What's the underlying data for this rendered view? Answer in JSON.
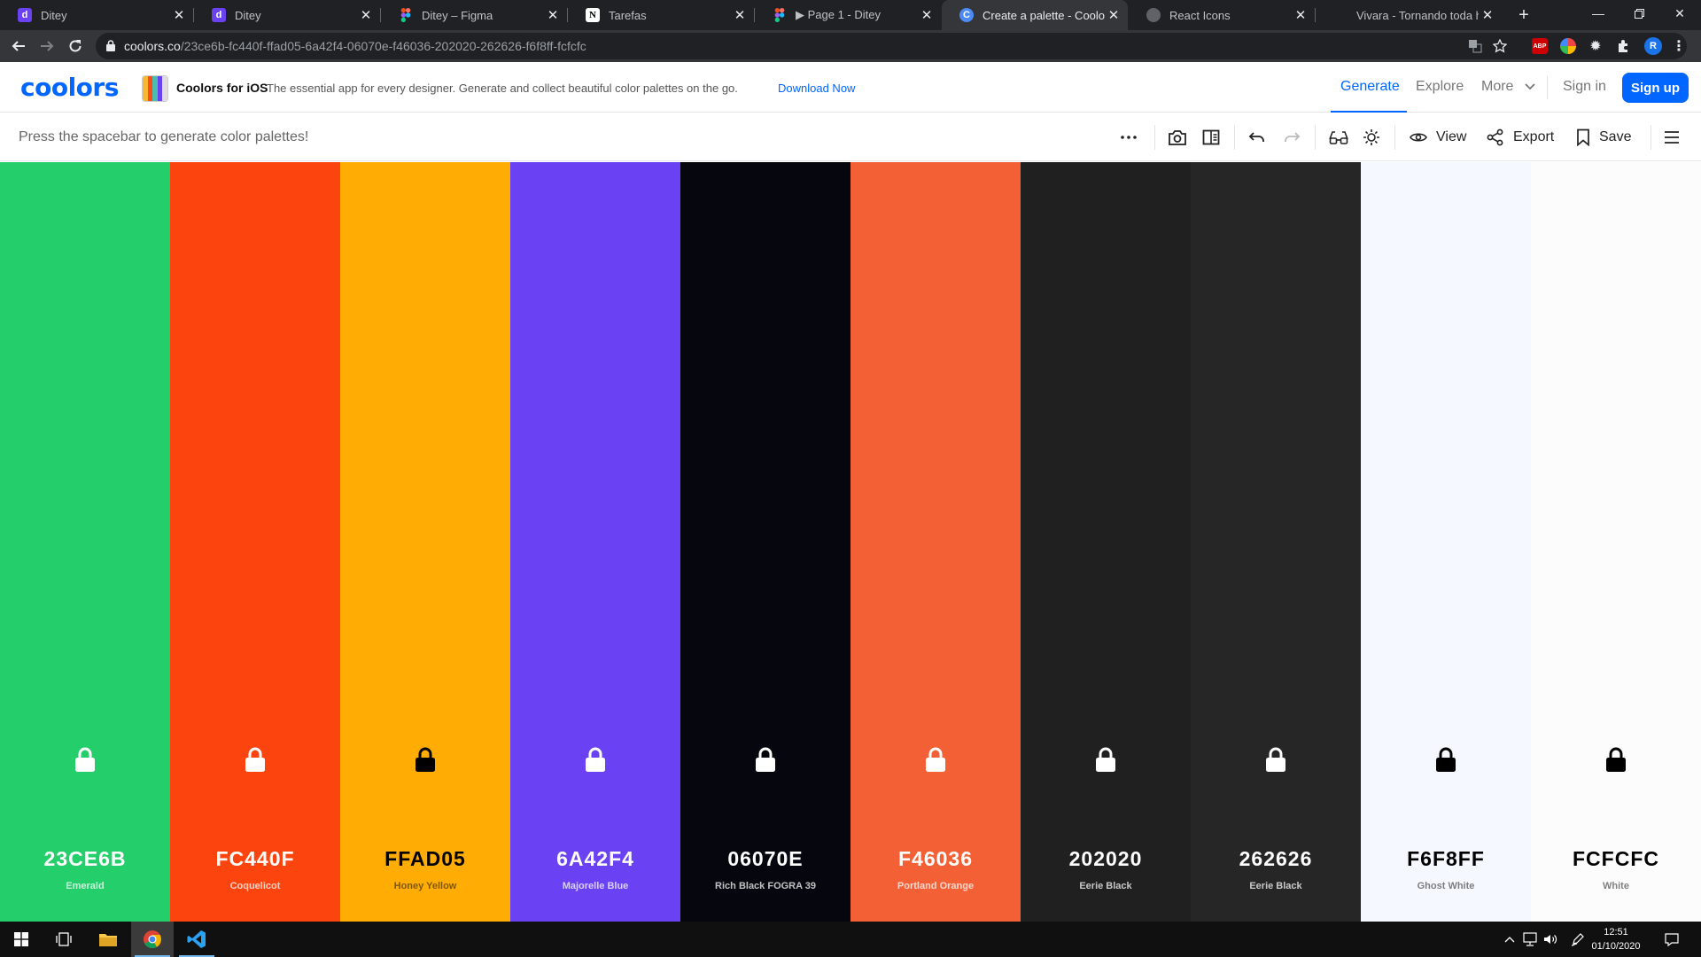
{
  "browser": {
    "tabs": [
      {
        "title": "Ditey",
        "favicon": "ditey-icon",
        "active": false
      },
      {
        "title": "Ditey",
        "favicon": "ditey-icon",
        "active": false
      },
      {
        "title": "Ditey – Figma",
        "favicon": "figma-icon",
        "active": false
      },
      {
        "title": "Tarefas",
        "favicon": "notion-icon",
        "active": false
      },
      {
        "title": "▶ Page 1 - Ditey",
        "favicon": "figma-icon",
        "active": false
      },
      {
        "title": "Create a palette - Coolors",
        "favicon": "coolors-icon",
        "active": true
      },
      {
        "title": "React Icons",
        "favicon": "globe-icon",
        "active": false
      },
      {
        "title": "Vivara - Tornando toda hist",
        "favicon": "none",
        "active": false
      }
    ],
    "url_host": "coolors.co",
    "url_path": "/23ce6b-fc440f-ffad05-6a42f4-06070e-f46036-202020-262626-f6f8ff-fcfcfc",
    "extensions": {
      "abp": "ABP",
      "profile": "R"
    }
  },
  "header": {
    "logo": "coolors",
    "promo_title": "Coolors for iOS",
    "promo_text": "The essential app for every designer. Generate and collect beautiful color palettes on the go.",
    "promo_link": "Download Now",
    "nav": {
      "generate": "Generate",
      "explore": "Explore",
      "more": "More",
      "sign_in": "Sign in",
      "sign_up": "Sign up"
    }
  },
  "toolbar": {
    "hint": "Press the spacebar to generate color palettes!",
    "view": "View",
    "export": "Export",
    "save": "Save"
  },
  "palette": [
    {
      "hex": "23CE6B",
      "name": "Emerald",
      "color": "#23CE6B",
      "text_color": "#FFFFFF",
      "name_color": "rgba(255,255,255,0.75)"
    },
    {
      "hex": "FC440F",
      "name": "Coquelicot",
      "color": "#FC440F",
      "text_color": "#FFFFFF",
      "name_color": "rgba(255,255,255,0.75)"
    },
    {
      "hex": "FFAD05",
      "name": "Honey Yellow",
      "color": "#FFAD05",
      "text_color": "#000000",
      "name_color": "rgba(0,0,0,0.5)"
    },
    {
      "hex": "6A42F4",
      "name": "Majorelle Blue",
      "color": "#6A42F4",
      "text_color": "#FFFFFF",
      "name_color": "rgba(255,255,255,0.75)"
    },
    {
      "hex": "06070E",
      "name": "Rich Black FOGRA 39",
      "color": "#06070E",
      "text_color": "#FFFFFF",
      "name_color": "rgba(255,255,255,0.75)"
    },
    {
      "hex": "F46036",
      "name": "Portland Orange",
      "color": "#F46036",
      "text_color": "#FFFFFF",
      "name_color": "rgba(255,255,255,0.75)"
    },
    {
      "hex": "202020",
      "name": "Eerie Black",
      "color": "#202020",
      "text_color": "#FFFFFF",
      "name_color": "rgba(255,255,255,0.75)"
    },
    {
      "hex": "262626",
      "name": "Eerie Black",
      "color": "#262626",
      "text_color": "#FFFFFF",
      "name_color": "rgba(255,255,255,0.75)"
    },
    {
      "hex": "F6F8FF",
      "name": "Ghost White",
      "color": "#F6F8FF",
      "text_color": "#000000",
      "name_color": "rgba(0,0,0,0.5)"
    },
    {
      "hex": "FCFCFC",
      "name": "White",
      "color": "#FCFCFC",
      "text_color": "#000000",
      "name_color": "rgba(0,0,0,0.5)"
    }
  ],
  "taskbar": {
    "time": "12:51",
    "date": "01/10/2020"
  },
  "colors": {
    "brand": "#0066FF"
  }
}
